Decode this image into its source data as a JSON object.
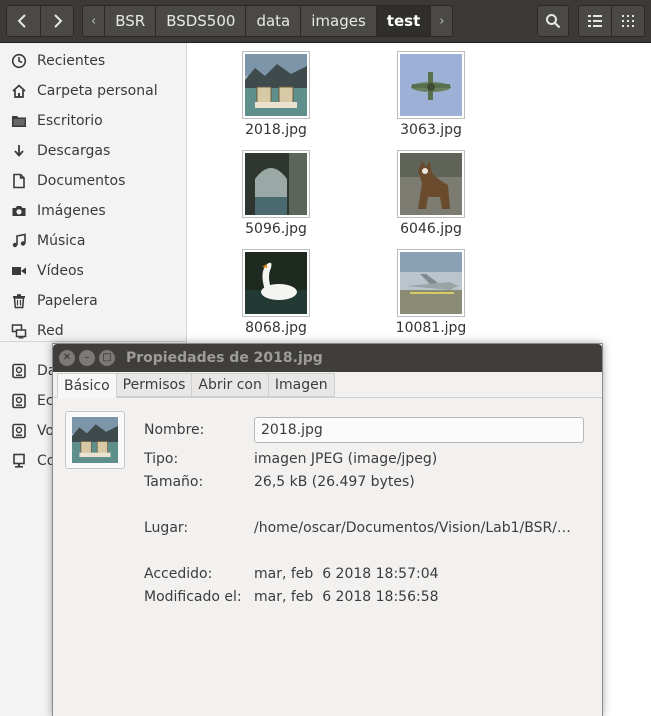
{
  "path": {
    "crumbs": [
      "BSR",
      "BSDS500",
      "data",
      "images",
      "test"
    ]
  },
  "sidebar": {
    "items": [
      {
        "label": "Recientes",
        "icon": "clock-icon"
      },
      {
        "label": "Carpeta personal",
        "icon": "home-icon"
      },
      {
        "label": "Escritorio",
        "icon": "folder-icon"
      },
      {
        "label": "Descargas",
        "icon": "download-icon"
      },
      {
        "label": "Documentos",
        "icon": "document-icon"
      },
      {
        "label": "Imágenes",
        "icon": "camera-icon"
      },
      {
        "label": "Música",
        "icon": "music-icon"
      },
      {
        "label": "Vídeos",
        "icon": "video-icon"
      },
      {
        "label": "Papelera",
        "icon": "trash-icon"
      },
      {
        "label": "Red",
        "icon": "network-icon"
      },
      {
        "label": "Da",
        "icon": "drive-icon"
      },
      {
        "label": "Ec",
        "icon": "drive-icon"
      },
      {
        "label": "Vo",
        "icon": "drive-icon"
      },
      {
        "label": "Co",
        "icon": "computer-icon"
      }
    ]
  },
  "files": [
    {
      "name": "2018.jpg"
    },
    {
      "name": "3063.jpg"
    },
    {
      "name": "5096.jpg"
    },
    {
      "name": "6046.jpg"
    },
    {
      "name": "8068.jpg"
    },
    {
      "name": "10081.jpg"
    }
  ],
  "dialog": {
    "title": "Propiedades de 2018.jpg",
    "tabs": [
      "Básico",
      "Permisos",
      "Abrir con",
      "Imagen"
    ],
    "labels": {
      "name": "Nombre:",
      "type": "Tipo:",
      "size": "Tamaño:",
      "location": "Lugar:",
      "accessed": "Accedido:",
      "modified": "Modificado el:"
    },
    "values": {
      "name": "2018.jpg",
      "type": "imagen JPEG (image/jpeg)",
      "size": "26,5 kB (26.497 bytes)",
      "location": "/home/oscar/Documentos/Vision/Lab1/BSR/…",
      "accessed": "mar, feb  6 2018 18:57:04",
      "modified": "mar, feb  6 2018 18:56:58"
    }
  }
}
